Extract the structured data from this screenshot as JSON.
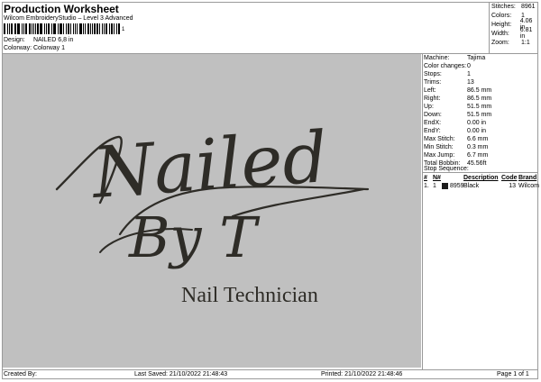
{
  "header": {
    "title": "Production Worksheet",
    "subtitle": "Wilcom EmbroideryStudio – Level 3 Advanced",
    "barcode_number": "1",
    "design_label": "Design:",
    "design_value": "NAILED 6,8 in",
    "colorway_label": "Colorway:",
    "colorway_value": "Colorway 1"
  },
  "stats": [
    {
      "label": "Stitches:",
      "value": "8961"
    },
    {
      "label": "Colors:",
      "value": "1"
    },
    {
      "label": "Height:",
      "value": "4.06 in"
    },
    {
      "label": "Width:",
      "value": "6.81 in"
    },
    {
      "label": "Zoom:",
      "value": "1:1"
    }
  ],
  "design_canvas": {
    "script_line1": "Nailed",
    "script_line2": "By T",
    "caption": "Nail Technician",
    "thread_color": "#2e2c27",
    "background_color": "#c0c0c0"
  },
  "machine_info": [
    {
      "label": "Machine:",
      "value": "Tajima"
    },
    {
      "label": "Color changes:",
      "value": "0"
    },
    {
      "label": "Stops:",
      "value": "1"
    },
    {
      "label": "Trims:",
      "value": "13"
    },
    {
      "label": "Left:",
      "value": "86.5 mm"
    },
    {
      "label": "Right:",
      "value": "86.5 mm"
    },
    {
      "label": "Up:",
      "value": "51.5 mm"
    },
    {
      "label": "Down:",
      "value": "51.5 mm"
    },
    {
      "label": "EndX:",
      "value": "0.00 in"
    },
    {
      "label": "EndY:",
      "value": "0.00 in"
    },
    {
      "label": "Max Stitch:",
      "value": "6.6 mm"
    },
    {
      "label": "Min Stitch:",
      "value": "0.3 mm"
    },
    {
      "label": "Max Jump:",
      "value": "6.7 mm"
    },
    {
      "label": "Total Bobbin:",
      "value": "45.56ft"
    }
  ],
  "stop_sequence": {
    "title": "Stop Sequence:",
    "columns": [
      "#",
      "N#",
      "",
      "Description",
      "Code",
      "Brand"
    ],
    "rows": [
      {
        "index": "1.",
        "n": "1",
        "swatch_color": "#1c1c1c",
        "number": "8959",
        "description": "Black",
        "code": "13",
        "brand": "Wilcom"
      }
    ]
  },
  "footer": {
    "created_by": "Created By:",
    "last_saved": "Last Saved: 21/10/2022 21:48:43",
    "printed": "Printed: 21/10/2022 21:48:46",
    "page": "Page 1 of 1"
  }
}
